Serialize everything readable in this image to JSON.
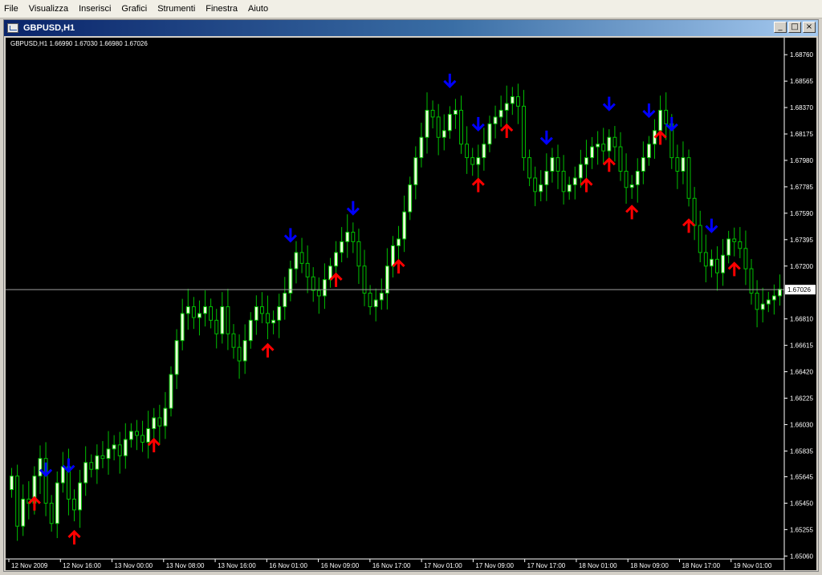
{
  "menu": {
    "items": [
      "File",
      "Visualizza",
      "Inserisci",
      "Grafici",
      "Strumenti",
      "Finestra",
      "Aiuto"
    ]
  },
  "window": {
    "title": "GBPUSD,H1",
    "controls": {
      "minimize": "_",
      "maximize": "□",
      "close": "×"
    }
  },
  "chart_data": {
    "type": "candlestick",
    "symbol_info": "GBPUSD,H1  1.66990 1.67030 1.66980 1.67026",
    "current_price": "1.67026",
    "current_price_value": 1.67026,
    "ylim": [
      1.6505,
      1.6885
    ],
    "y_ticks": [
      "1.68760",
      "1.68565",
      "1.68370",
      "1.68175",
      "1.67980",
      "1.67785",
      "1.67590",
      "1.67395",
      "1.67200",
      "1.66810",
      "1.66615",
      "1.66420",
      "1.66225",
      "1.66030",
      "1.65835",
      "1.65645",
      "1.65450",
      "1.65255",
      "1.65060"
    ],
    "x_labels": [
      "12 Nov 2009",
      "12 Nov 16:00",
      "13 Nov 00:00",
      "13 Nov 08:00",
      "13 Nov 16:00",
      "16 Nov 01:00",
      "16 Nov 09:00",
      "16 Nov 17:00",
      "17 Nov 01:00",
      "17 Nov 09:00",
      "17 Nov 17:00",
      "18 Nov 01:00",
      "18 Nov 09:00",
      "18 Nov 17:00",
      "19 Nov 01:00"
    ],
    "bar_count": 120,
    "closes": [
      1.6565,
      1.6528,
      1.6548,
      1.6545,
      1.6565,
      1.6578,
      1.6545,
      1.653,
      1.656,
      1.6572,
      1.6548,
      1.654,
      1.656,
      1.6575,
      1.657,
      1.658,
      1.6578,
      1.6585,
      1.6588,
      1.658,
      1.6592,
      1.6598,
      1.6595,
      1.659,
      1.66,
      1.6608,
      1.6602,
      1.6615,
      1.664,
      1.6665,
      1.6685,
      1.669,
      1.6682,
      1.6685,
      1.669,
      1.668,
      1.667,
      1.669,
      1.667,
      1.666,
      1.665,
      1.6665,
      1.668,
      1.669,
      1.6685,
      1.6678,
      1.668,
      1.669,
      1.67,
      1.6718,
      1.673,
      1.6722,
      1.6712,
      1.6702,
      1.6698,
      1.671,
      1.672,
      1.673,
      1.6738,
      1.6745,
      1.6738,
      1.672,
      1.67,
      1.669,
      1.6695,
      1.67,
      1.672,
      1.6735,
      1.674,
      1.676,
      1.678,
      1.68,
      1.6815,
      1.6835,
      1.683,
      1.6815,
      1.682,
      1.6832,
      1.6835,
      1.681,
      1.68,
      1.6795,
      1.68,
      1.681,
      1.6825,
      1.683,
      1.6835,
      1.684,
      1.6845,
      1.6838,
      1.68,
      1.6785,
      1.6775,
      1.678,
      1.679,
      1.68,
      1.679,
      1.6775,
      1.678,
      1.6785,
      1.6795,
      1.68,
      1.6808,
      1.681,
      1.6805,
      1.6815,
      1.6808,
      1.679,
      1.6778,
      1.678,
      1.679,
      1.68,
      1.681,
      1.682,
      1.6835,
      1.6825,
      1.68,
      1.679,
      1.68,
      1.677,
      1.675,
      1.673,
      1.672,
      1.6725,
      1.6715,
      1.6728,
      1.674,
      1.6738,
      1.6733,
      1.6718,
      1.67,
      1.6688,
      1.6692,
      1.6695,
      1.6698,
      1.6703
    ],
    "buy_arrows": [
      4,
      11,
      25,
      45,
      57,
      68,
      82,
      87,
      101,
      105,
      109,
      114,
      119,
      127,
      136
    ],
    "sell_arrows": [
      6,
      10,
      49,
      60,
      77,
      82,
      94,
      105,
      112,
      116,
      123
    ],
    "colors": {
      "background": "#000000",
      "bull_candle": "#eaffd8",
      "bear_candle": "#00c000",
      "wick": "#00c000",
      "grid_text": "#ffffff",
      "buy_arrow": "#ff0000",
      "sell_arrow": "#0000ff",
      "price_line": "#a0a0a0"
    }
  }
}
